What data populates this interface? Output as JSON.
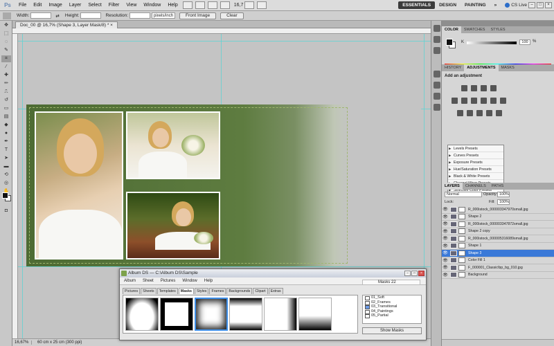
{
  "menubar": {
    "logo": "Ps",
    "items": [
      "File",
      "Edit",
      "Image",
      "Layer",
      "Select",
      "Filter",
      "View",
      "Window",
      "Help"
    ],
    "zoom": "16,7",
    "workspaces": [
      "ESSENTIALS",
      "DESIGN",
      "PAINTING"
    ],
    "more": "»",
    "cslive": "CS Live"
  },
  "options": {
    "width_label": "Width:",
    "height_label": "Height:",
    "resolution_label": "Resolution:",
    "resolution_unit": "pixels/inch",
    "front_image": "Front Image",
    "clear": "Clear"
  },
  "document": {
    "tab": "Doc_00 @ 16,7% (Shape 3, Layer Mask/8) *",
    "status_zoom": "16,67%",
    "status_info": "60 cm x 25 cm (300 ppi)"
  },
  "color_panel": {
    "tabs": [
      "COLOR",
      "SWATCHES",
      "STYLES"
    ],
    "channel": "K",
    "value": "100",
    "unit": "%"
  },
  "adjustments_panel": {
    "tabs": [
      "HISTORY",
      "ADJUSTMENTS",
      "MASKS"
    ],
    "title": "Add an adjustment",
    "presets": [
      "Levels Presets",
      "Curves Presets",
      "Exposure Presets",
      "Hue/Saturation Presets",
      "Black & White Presets",
      "Channel Mixer Presets",
      "Selective Color Presets"
    ]
  },
  "layers_panel": {
    "tabs": [
      "LAYERS",
      "CHANNELS",
      "PATHS"
    ],
    "blend_mode": "Normal",
    "opacity_label": "Opacity:",
    "opacity": "100%",
    "lock_label": "Lock:",
    "fill_label": "Fill:",
    "fill": "100%",
    "layers": [
      {
        "name": "R_000istock_000003347970small.jpg",
        "selected": false
      },
      {
        "name": "Shape 2",
        "selected": false
      },
      {
        "name": "R_000istock_000003347872small.jpg",
        "selected": false
      },
      {
        "name": "Shape 2 copy",
        "selected": false
      },
      {
        "name": "R_000istock_000005316089small.jpg",
        "selected": false
      },
      {
        "name": "Shape 1",
        "selected": false
      },
      {
        "name": "Shape 3",
        "selected": true
      },
      {
        "name": "Color Fill 1",
        "selected": false
      },
      {
        "name": "F_000001_Classic\\bp_bg_010.jpg",
        "selected": false
      },
      {
        "name": "Background",
        "selected": false
      }
    ]
  },
  "albumds": {
    "title": "Album DS  —  C:\\Album DS\\Sample",
    "menu": [
      "Album",
      "Sheet",
      "Pictures",
      "Window",
      "Help"
    ],
    "masks_count": "Masks  22",
    "tabs": [
      "Pictures",
      "Sheets",
      "Templates",
      "Masks",
      "Styles",
      "Frames",
      "Backgrounds",
      "Clipart",
      "Extras"
    ],
    "active_tab": "Masks",
    "list": [
      "01_Soft",
      "02_Frames",
      "03_Transitional",
      "04_Paintings",
      "05_Partial"
    ],
    "checked": "03_Transitional",
    "show_button": "Show Masks"
  }
}
